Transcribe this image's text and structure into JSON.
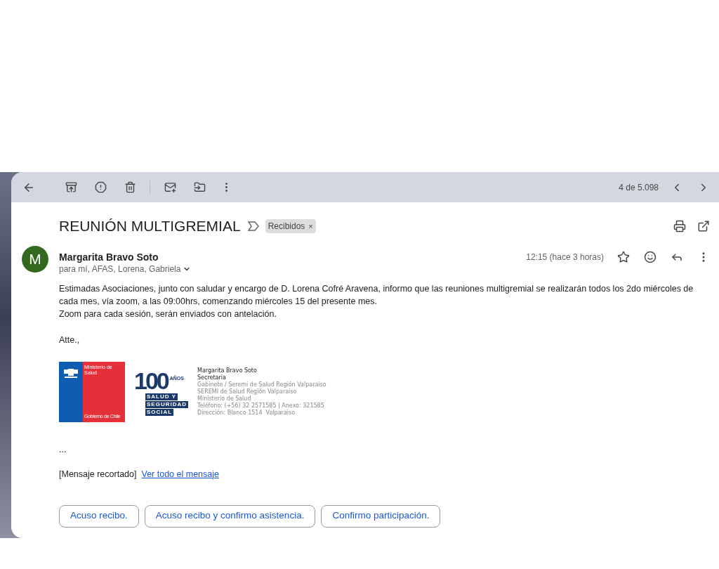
{
  "toolbar": {
    "counter": "4 de 5.098"
  },
  "subject": {
    "title": "REUNIÓN MULTIGREMIAL",
    "label": "Recibidos",
    "label_close": "×"
  },
  "message": {
    "avatar": "M",
    "sender": "Margarita Bravo Soto",
    "recipients": "para mí, AFAS, Lorena, Gabriela",
    "time": "12:15 (hace 3 horas)",
    "body": [
      "Estimadas Asociaciones, junto con saludar y encargo de D. Lorena Cofré Aravena, informo que las reuniones multigremial se realizarán todos los 2do miércoles de cada mes, vía zoom, a las 09:00hrs, comenzando miércoles 15 del presente mes.",
      "Zoom para cada sesión, serán enviados con antelación."
    ],
    "closing": "Atte.,",
    "signature": {
      "logo_ministry": [
        "Ministerio de Salud",
        "Gobierno de Chile"
      ],
      "logo_anniversary": {
        "number": "100",
        "years": "AÑOS",
        "lines": [
          "SALUD Y",
          "SEGURIDAD",
          "SOCIAL"
        ]
      },
      "name": "Margarita Bravo Soto",
      "role": "Secretaria",
      "lines": [
        "Gabinete / Seremi de Salud Región Valparaiso",
        "SEREMI de Salud Región Valparaiso",
        "Ministerio de Salud",
        "Teléfono: (+56) 32 2571585 | Anexo: 321585",
        "Dirección: Blanco 1514  Valparaiso"
      ]
    },
    "ellipsis": "...",
    "clipped": "[Mensaje recortado]",
    "view_all": "Ver todo el mensaje"
  },
  "smart_replies": [
    "Acuso recibo.",
    "Acuso recibo y confirmo asistencia.",
    "Confirmo participación."
  ]
}
